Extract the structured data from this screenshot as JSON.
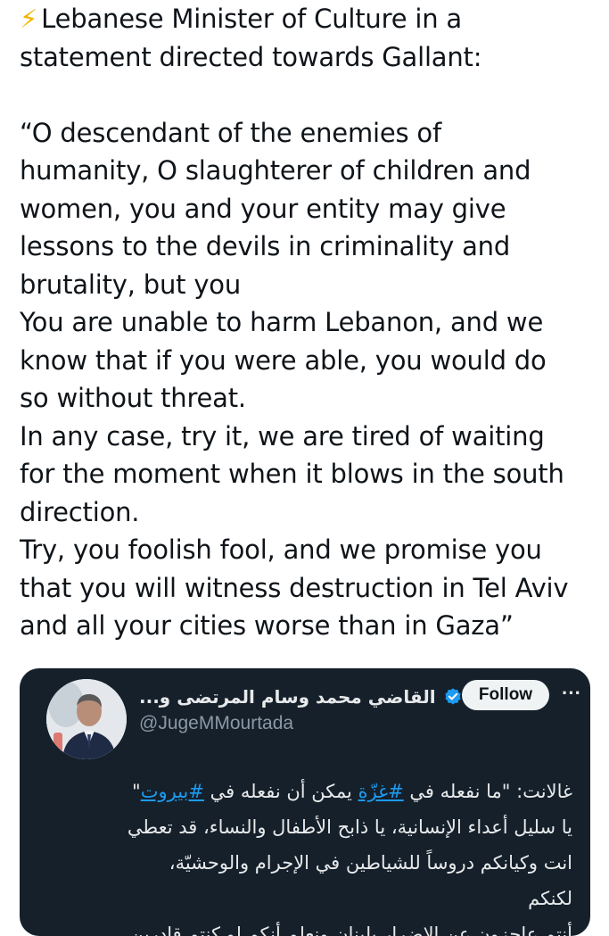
{
  "post": {
    "bolt_icon": "⚡",
    "lines": [
      "Lebanese Minister of Culture in a",
      "statement directed towards Gallant:",
      "",
      "“O descendant of the enemies of",
      "humanity, O slaughterer of children and",
      "women, you and your entity may give",
      "lessons to the devils in criminality and",
      "brutality, but you",
      "You are unable to harm Lebanon, and we",
      "know that if you were able, you would do",
      "so without threat.",
      "In any case, try it, we are tired of waiting",
      "for the moment when it blows in the south",
      "direction.",
      "Try, you foolish fool, and we promise you",
      "that you will witness destruction in Tel Aviv",
      "and all your cities worse than in Gaza”"
    ]
  },
  "embed": {
    "name": "القاضي محمد وسام المرتضى و...",
    "handle": "@JugeMMourtada",
    "follow_label": "Follow",
    "more_label": "···",
    "verified_color": "#1d9bf0",
    "arabic": {
      "line1_prefix": "غالانت: \"ما نفعله في ",
      "line1_tag1": "#غزّة",
      "line1_mid": " يمكن أن نفعله في ",
      "line1_tag2": "#بيروت",
      "line1_suffix": "\"",
      "line2": "يا سليل أعداء الإنسانية، يا ذابح الأطفال والنساء، قد تعطي",
      "line3": "انت وكيانكم دروساً للشياطين في الإجرام والوحشيّة،",
      "line4": "لكنكم",
      "line5": "أنتم عاجزون عن الإضرار بلبنان ونعلم أنكم لو كنتم قادرين"
    }
  }
}
